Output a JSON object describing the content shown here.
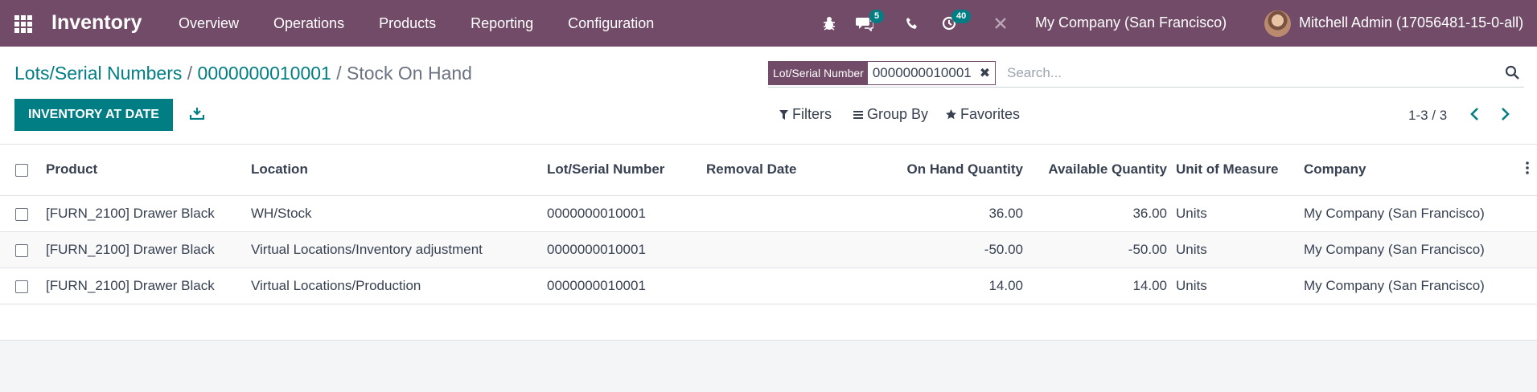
{
  "navbar": {
    "brand": "Inventory",
    "menu": [
      "Overview",
      "Operations",
      "Products",
      "Reporting",
      "Configuration"
    ],
    "messages_badge": "5",
    "activities_badge": "40",
    "company": "My Company (San Francisco)",
    "user": "Mitchell Admin (17056481-15-0-all)",
    "accent_color": "#714b67"
  },
  "breadcrumb": {
    "items": [
      "Lots/Serial Numbers",
      "0000000010001"
    ],
    "separator": "/",
    "current": "Stock On Hand"
  },
  "search": {
    "facet_label": "Lot/Serial Number",
    "facet_value": "0000000010001",
    "placeholder": "Search..."
  },
  "toolbar": {
    "primary_button": "INVENTORY AT DATE",
    "filters": "Filters",
    "group_by": "Group By",
    "favorites": "Favorites",
    "pager": "1-3 / 3",
    "primary_color": "#017e84"
  },
  "table": {
    "columns": [
      "Product",
      "Location",
      "Lot/Serial Number",
      "Removal Date",
      "On Hand Quantity",
      "Available Quantity",
      "Unit of Measure",
      "Company"
    ],
    "rows": [
      {
        "product": "[FURN_2100] Drawer Black",
        "location": "WH/Stock",
        "lot": "0000000010001",
        "removal_date": "",
        "on_hand": "36.00",
        "available": "36.00",
        "uom": "Units",
        "company": "My Company (San Francisco)"
      },
      {
        "product": "[FURN_2100] Drawer Black",
        "location": "Virtual Locations/Inventory adjustment",
        "lot": "0000000010001",
        "removal_date": "",
        "on_hand": "-50.00",
        "available": "-50.00",
        "uom": "Units",
        "company": "My Company (San Francisco)"
      },
      {
        "product": "[FURN_2100] Drawer Black",
        "location": "Virtual Locations/Production",
        "lot": "0000000010001",
        "removal_date": "",
        "on_hand": "14.00",
        "available": "14.00",
        "uom": "Units",
        "company": "My Company (San Francisco)"
      }
    ]
  }
}
